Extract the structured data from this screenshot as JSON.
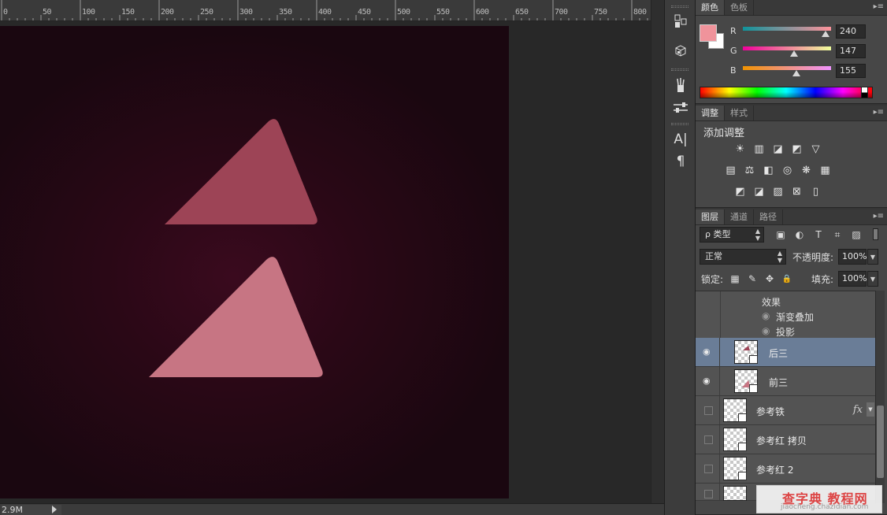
{
  "ruler": {
    "labels": [
      "0",
      "50",
      "100",
      "150",
      "200",
      "250",
      "300",
      "350",
      "400",
      "450",
      "500",
      "550",
      "600",
      "650",
      "700",
      "750",
      "800"
    ]
  },
  "status": {
    "doc_size": "2.9M"
  },
  "document": {
    "colors": {
      "back_triangle": "#9d4456",
      "front_triangle": "#c77583"
    }
  },
  "toolbar_icons": [
    "history-icon",
    "3d-object-icon",
    "brushes-icon",
    "sliders-icon",
    "character-icon",
    "paragraph-icon"
  ],
  "color_panel": {
    "tabs": [
      "颜色",
      "色板"
    ],
    "foreground": "#f0939b",
    "background": "#ffffff",
    "channels": [
      {
        "label": "R",
        "value": "240",
        "fraction": 0.94
      },
      {
        "label": "G",
        "value": "147",
        "fraction": 0.58
      },
      {
        "label": "B",
        "value": "155",
        "fraction": 0.61
      }
    ]
  },
  "adjust_panel": {
    "tabs": [
      "调整",
      "样式"
    ],
    "title": "添加调整",
    "row1": [
      "☀",
      "▥",
      "◪",
      "◩",
      "▽"
    ],
    "row2": [
      "▤",
      "⚖",
      "◧",
      "◎",
      "❋",
      "▦"
    ],
    "row3": [
      "◩",
      "◪",
      "▨",
      "⊠",
      "▯"
    ]
  },
  "layers_panel": {
    "tabs": [
      "图层",
      "通道",
      "路径"
    ],
    "filter_label": "ρ 类型",
    "filter_icons": [
      "▣",
      "◐",
      "T",
      "⌗",
      "▨"
    ],
    "blend_mode": "正常",
    "opacity_label": "不透明度:",
    "opacity_value": "100%",
    "lock_label": "锁定:",
    "lock_icons": [
      "▦",
      "✎",
      "✥",
      "🔒"
    ],
    "fill_label": "填充:",
    "fill_value": "100%",
    "effects_label": "效果",
    "effects": [
      "渐变叠加",
      "投影"
    ],
    "layers": [
      {
        "name": "后三",
        "visible": true,
        "selected": true,
        "fx": false
      },
      {
        "name": "前三",
        "visible": true,
        "selected": false,
        "fx": false
      },
      {
        "name": "参考铁",
        "visible": false,
        "selected": false,
        "fx": true
      },
      {
        "name": "参考红 拷贝",
        "visible": false,
        "selected": false,
        "fx": false
      },
      {
        "name": "参考红 2",
        "visible": false,
        "selected": false,
        "fx": false
      }
    ],
    "fx_label": "fx"
  },
  "watermark": {
    "main": "查字典 教程网",
    "sub": "jiaocheng.chazidian.com"
  }
}
